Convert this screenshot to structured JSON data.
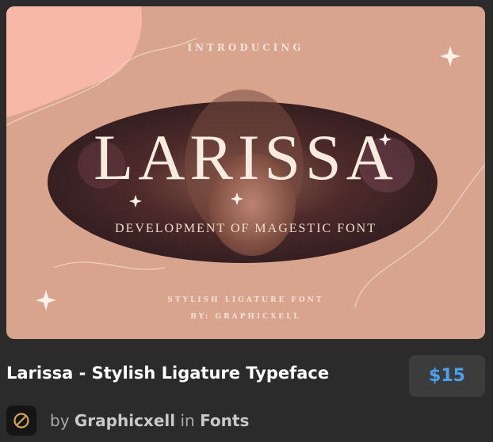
{
  "item": {
    "image": {
      "introducing": "INTRODUCING",
      "big_title": "LARISSA",
      "subtitle": "DEVELOPMENT OF MAGESTIC FONT",
      "stylish": "STYLISH LIGATURE FONT",
      "by_line": "BY: GRAPHICXELL"
    },
    "title": "Larissa - Stylish Ligature Typeface",
    "price": "$15",
    "by_word": "by",
    "author": "Graphicxell",
    "in_word": "in",
    "category": "Fonts"
  },
  "colors": {
    "background": "#2b2b2b",
    "card_bg": "#d8a48d",
    "price_color": "#4aa3ef",
    "price_box": "#3c3c3c"
  }
}
